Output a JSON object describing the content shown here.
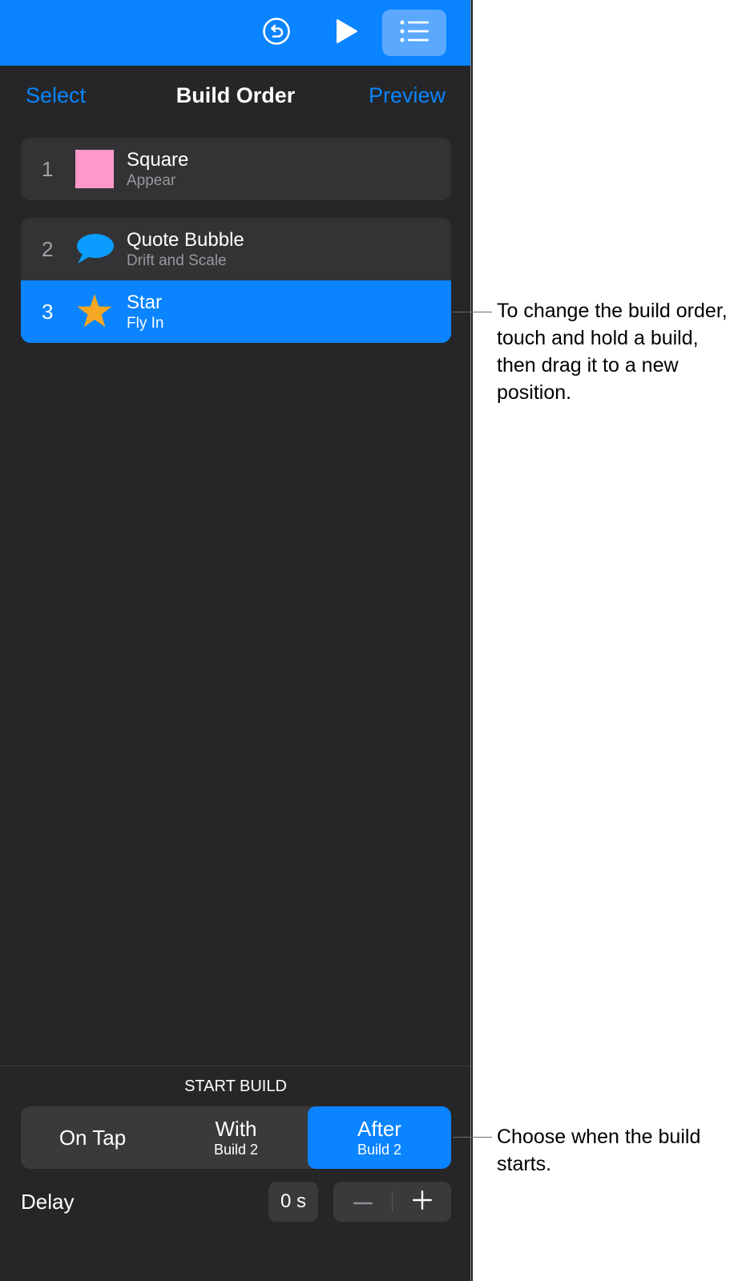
{
  "toolbar": {
    "icons": [
      "undo-icon",
      "play-icon",
      "list-icon"
    ],
    "accent": "#0a84ff"
  },
  "nav": {
    "select_label": "Select",
    "title": "Build Order",
    "preview_label": "Preview"
  },
  "builds": [
    {
      "number": "1",
      "title": "Square",
      "effect": "Appear",
      "icon": "pink-square-icon",
      "color": "#ff99cc",
      "selected": false
    },
    {
      "number": "2",
      "title": "Quote Bubble",
      "effect": "Drift and Scale",
      "icon": "speech-bubble-icon",
      "color": "#0a9cff",
      "selected": false
    },
    {
      "number": "3",
      "title": "Star",
      "effect": "Fly In",
      "icon": "star-icon",
      "color": "#f5a623",
      "selected": true
    }
  ],
  "start_build": {
    "label": "START BUILD",
    "options": [
      {
        "main": "On Tap",
        "sub": ""
      },
      {
        "main": "With",
        "sub": "Build 2"
      },
      {
        "main": "After",
        "sub": "Build 2"
      }
    ],
    "selected": "After"
  },
  "delay": {
    "label": "Delay",
    "value": "0 s"
  },
  "callouts": [
    "To change the build order, touch and hold a build, then drag it to a new position.",
    "Choose when the build starts."
  ]
}
